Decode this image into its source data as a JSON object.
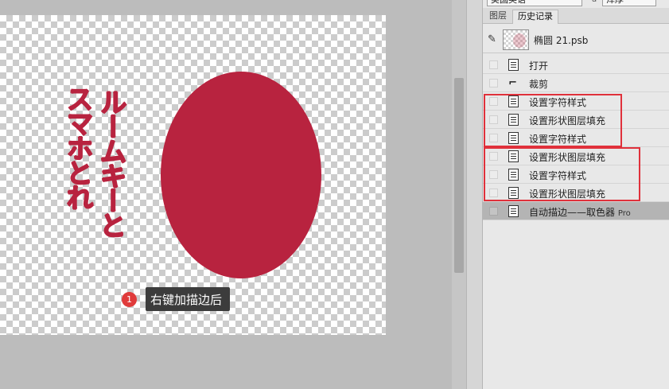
{
  "canvas": {
    "vertical_text_left": "スマホとれ",
    "vertical_text_right": "ルームキーと",
    "ellipse_color": "#b8233f",
    "callout": {
      "badge": "1",
      "text": "右键加描边后"
    }
  },
  "panel": {
    "font_family": "美国英语",
    "font_aa_icon": "a",
    "font_style": "浑厚",
    "tabs": [
      "图层",
      "历史记录"
    ],
    "snapshot": {
      "brush_icon": "brush-icon",
      "label": "椭圆 21.psb"
    },
    "history": [
      {
        "icon": "document-icon",
        "label": "打开"
      },
      {
        "icon": "crop-icon",
        "label": "裁剪"
      },
      {
        "icon": "document-icon",
        "label": "设置字符样式"
      },
      {
        "icon": "document-icon",
        "label": "设置形状图层填充"
      },
      {
        "icon": "document-icon",
        "label": "设置字符样式"
      },
      {
        "icon": "document-icon",
        "label": "设置形状图层填充"
      },
      {
        "icon": "document-icon",
        "label": "设置字符样式"
      },
      {
        "icon": "document-icon",
        "label": "设置形状图层填充"
      },
      {
        "icon": "document-icon",
        "label": "自动描边——取色器",
        "suffix": "Pro",
        "active": true
      }
    ]
  },
  "colors": {
    "accent": "#b8233f",
    "highlight_box": "#e0313b",
    "active_row": "#b4b4b4"
  }
}
